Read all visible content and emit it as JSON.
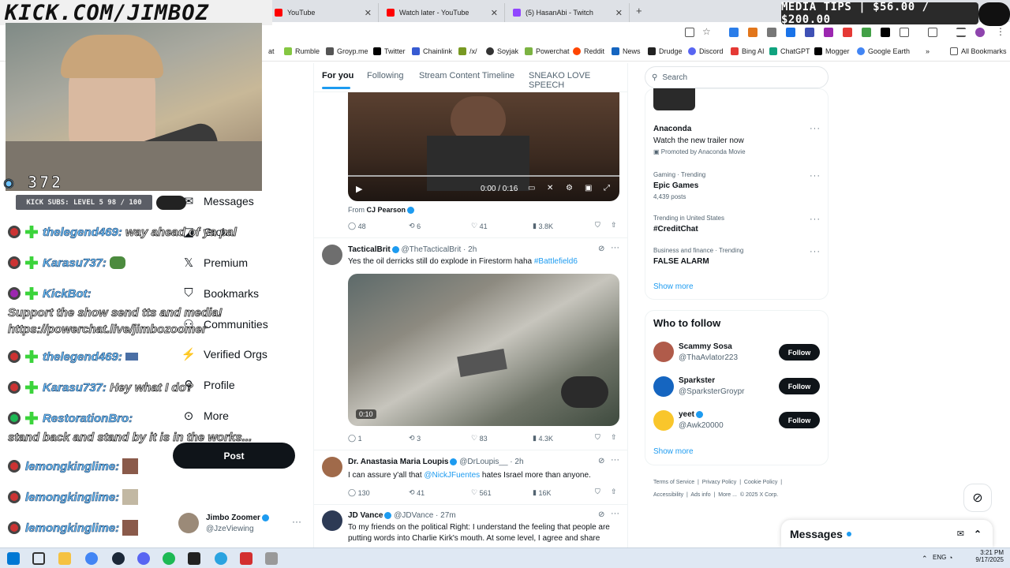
{
  "stream": {
    "site_header": "KICK.COM/JIMBOZ",
    "media_tips": "MEDIA TIPS | $56.00 / $200.00",
    "viewer_count": "372",
    "kick_subs": "KICK SUBS: LEVEL 5 98 / 100"
  },
  "browser": {
    "tabs": [
      {
        "label": "YouTube",
        "color": "#ff0000"
      },
      {
        "label": "Watch later - YouTube",
        "color": "#ff0000"
      },
      {
        "label": "(5) HasanAbi - Twitch",
        "color": "#9146ff"
      }
    ],
    "bookmarks": [
      "at",
      "Rumble",
      "Groyp.me",
      "Twitter",
      "Chainlink",
      "/x/",
      "Soyjak",
      "Powerchat",
      "Reddit",
      "News",
      "Drudge",
      "Discord",
      "Bing AI",
      "ChatGPT",
      "Mogger",
      "Google Earth"
    ],
    "all_bookmarks": "All Bookmarks"
  },
  "chat": [
    {
      "user": "thelegend469:",
      "text": "way ahead of ya pal"
    },
    {
      "user": "Karasu737:",
      "text": ""
    },
    {
      "user": "KickBot:",
      "text": ""
    },
    {
      "user": "",
      "text": "Support the show send tts and media!"
    },
    {
      "user": "",
      "text": "https://powerchat.live/jimbozoomer"
    },
    {
      "user": "thelegend469:",
      "text": ""
    },
    {
      "user": "Karasu737:",
      "text": "Hey what I do?"
    },
    {
      "user": "RestorationBro:",
      "text": ""
    },
    {
      "user": "",
      "text": "stand back and stand by it is in the works..."
    },
    {
      "user": "lemongkinglime:",
      "text": ""
    },
    {
      "user": "lemongkinglime:",
      "text": ""
    },
    {
      "user": "lemongkinglime:",
      "text": ""
    }
  ],
  "nav": {
    "items": [
      "Messages",
      "Grok",
      "Premium",
      "Bookmarks",
      "Communities",
      "Verified Orgs",
      "Profile",
      "More"
    ],
    "post": "Post",
    "account_name": "Jimbo Zoomer",
    "account_handle": "@JzeViewing"
  },
  "feed": {
    "tabs": [
      "For you",
      "Following",
      "Stream Content Timeline",
      "SNEAKO LOVE SPEECH"
    ],
    "video1": {
      "time": "0:00 / 0:16",
      "from_label": "From",
      "from": "CJ Pearson",
      "replies": "48",
      "reposts": "6",
      "likes": "41",
      "views": "3.8K"
    },
    "tweet2": {
      "name": "TacticalBrit",
      "handle": "@TheTacticalBrit · 2h",
      "text": "Yes the oil derricks still do explode in Firestorm haha",
      "hashtag": "#Battlefield6",
      "duration": "0:10",
      "replies": "1",
      "reposts": "3",
      "likes": "83",
      "views": "4.3K"
    },
    "tweet3": {
      "name": "Dr. Anastasia Maria Loupis",
      "handle": "@DrLoupis__ · 2h",
      "text_a": "I can assure y'all that",
      "mention": "@NickJFuentes",
      "text_b": "hates Israel more than anyone.",
      "replies": "130",
      "reposts": "41",
      "likes": "561",
      "views": "16K"
    },
    "tweet4": {
      "name": "JD Vance",
      "handle": "@JDVance · 27m",
      "text": "To my friends on the political Right: I understand the feeling that people are putting words into Charlie Kirk's mouth. At some level, I agree and share"
    }
  },
  "right": {
    "search": "Search",
    "ad": {
      "name": "Anaconda",
      "sub": "Watch the new trailer now",
      "promo": "Promoted by Anaconda Movie"
    },
    "trends": [
      {
        "ctx": "Gaming · Trending",
        "name": "Epic Games",
        "count": "4,439 posts"
      },
      {
        "ctx": "Trending in United States",
        "name": "#CreditChat",
        "count": ""
      },
      {
        "ctx": "Business and finance · Trending",
        "name": "FALSE ALARM",
        "count": ""
      }
    ],
    "show_more": "Show more",
    "wtf": "Who to follow",
    "people": [
      {
        "name": "Scammy Sosa",
        "handle": "@ThaAvlator223"
      },
      {
        "name": "Sparkster",
        "handle": "@SparksterGroypr"
      },
      {
        "name": "yeet",
        "handle": "@Awk20000"
      }
    ],
    "follow": "Follow",
    "footer": [
      "Terms of Service",
      "Privacy Policy",
      "Cookie Policy",
      "Accessibility",
      "Ads info",
      "More ...",
      "© 2025 X Corp."
    ],
    "messages": "Messages"
  },
  "taskbar": {
    "lang": "ENG",
    "time": "3:21 PM",
    "date": "9/17/2025"
  }
}
